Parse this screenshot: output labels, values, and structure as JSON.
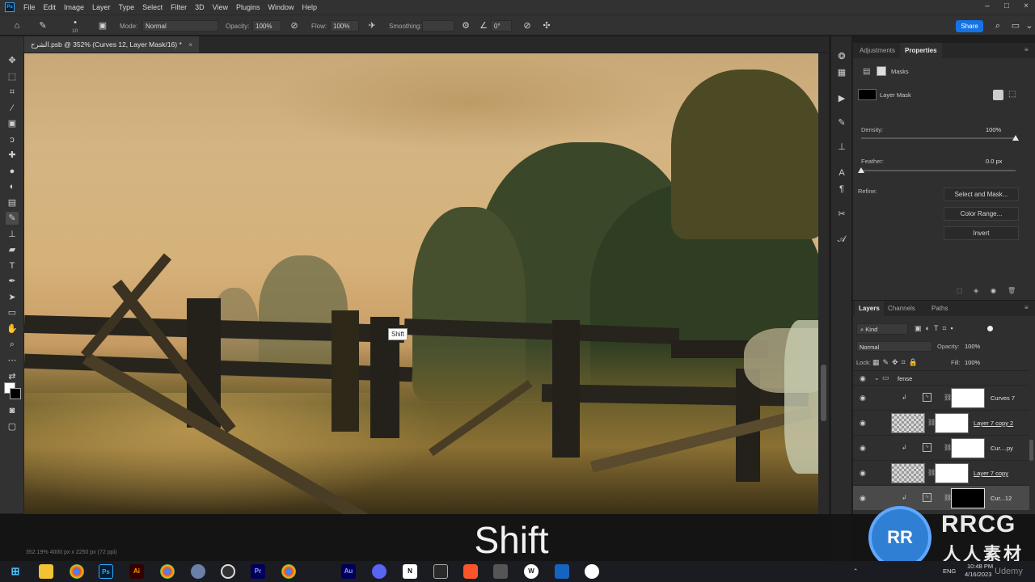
{
  "menubar": {
    "app_logo": "Ps",
    "items": [
      "File",
      "Edit",
      "Image",
      "Layer",
      "Type",
      "Select",
      "Filter",
      "3D",
      "View",
      "Plugins",
      "Window",
      "Help"
    ]
  },
  "options": {
    "brush_size": "10",
    "mode_label": "Mode:",
    "mode_value": "Normal",
    "opacity_label": "Opacity:",
    "opacity_value": "100%",
    "flow_label": "Flow:",
    "flow_value": "100%",
    "smoothing_label": "Smoothing:",
    "smoothing_value": "",
    "angle_value": "0°",
    "share_label": "Share"
  },
  "document": {
    "tab_title": "الشرح.psb @ 352% (Curves 12, Layer Mask/16) *",
    "close_glyph": "×",
    "tooltip": "Shift",
    "status": "352.19%     4000 px x 2250 px (72 ppi)"
  },
  "properties": {
    "tabs": [
      "Adjustments",
      "Properties"
    ],
    "section_label": "Masks",
    "mask_type": "Layer Mask",
    "density_label": "Density:",
    "density_value": "100%",
    "density": 1.0,
    "feather_label": "Feather:",
    "feather_value": "0.0 px",
    "feather": 0.0,
    "refine_label": "Refine:",
    "buttons": [
      "Select and Mask...",
      "Color Range...",
      "Invert"
    ]
  },
  "layers": {
    "tabs": [
      "Layers",
      "Channels",
      "Paths"
    ],
    "filter_value": "Kind",
    "blend_value": "Normal",
    "opacity_label": "Opacity:",
    "opacity_value": "100%",
    "lock_label": "Lock:",
    "fill_label": "Fill:",
    "fill_value": "100%",
    "group_name": "fense",
    "rows": [
      {
        "name": "Curves 7"
      },
      {
        "name": "Layer 7 copy 2"
      },
      {
        "name": "Cur....py"
      },
      {
        "name": "Layer 7 copy"
      },
      {
        "name": "Cur...12"
      }
    ]
  },
  "subtitle": "Shift",
  "watermark": {
    "logo": "RR",
    "line1": "RRCG",
    "line2": "人人素材"
  },
  "taskbar": {
    "lang": "ENG",
    "time": "10:48 PM",
    "date": "4/16/2023",
    "apps": [
      "Ps",
      "Ai",
      "Pr",
      "Au"
    ]
  },
  "udemy": "Udemy"
}
